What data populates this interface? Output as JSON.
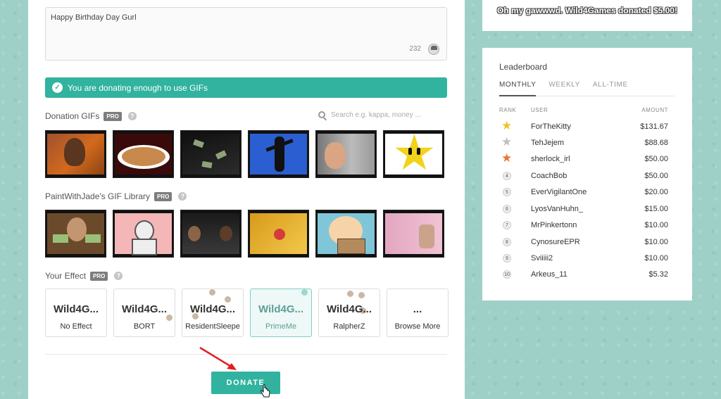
{
  "message": {
    "text": "Happy Birthday Day Gurl",
    "char_count": "232"
  },
  "alert": {
    "text": "You are donating enough to use GIFs"
  },
  "donation_gifs": {
    "label": "Donation GIFs",
    "pro": "PRO",
    "help": "?",
    "search_placeholder": "Search e.g. kappa, money ..."
  },
  "library": {
    "label": "PaintWithJade's GIF Library",
    "pro": "PRO",
    "help": "?"
  },
  "effects": {
    "label": "Your Effect",
    "pro": "PRO",
    "help": "?",
    "items": [
      {
        "title": "Wild4G...",
        "name": "No Effect"
      },
      {
        "title": "Wild4G...",
        "name": "BORT"
      },
      {
        "title": "Wild4G...",
        "name": "ResidentSleepe"
      },
      {
        "title": "Wild4G...",
        "name": "PrimeMe"
      },
      {
        "title": "Wild4G...",
        "name": "RalpherZ"
      },
      {
        "title": "...",
        "name": "Browse More"
      }
    ]
  },
  "donate_button": "DONATE",
  "top_card": {
    "text": "Oh my gawwwd. Wild4Games donated $5.00!"
  },
  "leaderboard": {
    "title": "Leaderboard",
    "tabs": [
      "MONTHLY",
      "WEEKLY",
      "ALL-TIME"
    ],
    "headers": {
      "rank": "RANK",
      "user": "USER",
      "amount": "AMOUNT"
    },
    "rows": [
      {
        "rank": "1",
        "user": "ForTheKitty",
        "amount": "$131.67"
      },
      {
        "rank": "2",
        "user": "TehJejem",
        "amount": "$88.68"
      },
      {
        "rank": "3",
        "user": "sherlock_irl",
        "amount": "$50.00"
      },
      {
        "rank": "4",
        "user": "CoachBob",
        "amount": "$50.00"
      },
      {
        "rank": "5",
        "user": "EverVigilantOne",
        "amount": "$20.00"
      },
      {
        "rank": "6",
        "user": "LyosVanHuhn_",
        "amount": "$15.00"
      },
      {
        "rank": "7",
        "user": "MrPinkertonn",
        "amount": "$10.00"
      },
      {
        "rank": "8",
        "user": "CynosureEPR",
        "amount": "$10.00"
      },
      {
        "rank": "9",
        "user": "Sviiiii2",
        "amount": "$10.00"
      },
      {
        "rank": "10",
        "user": "Arkeus_11",
        "amount": "$5.32"
      }
    ]
  },
  "colors": {
    "accent": "#31b39f",
    "background": "#9fd0c8"
  }
}
